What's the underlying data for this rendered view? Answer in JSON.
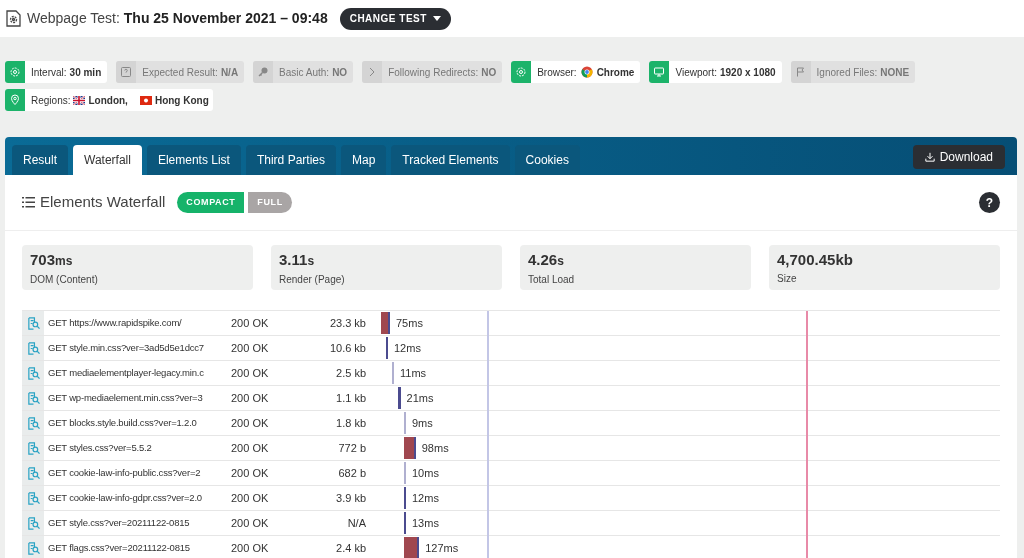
{
  "header": {
    "label": "Webpage Test:",
    "title": "Thu 25 November 2021 – 09:48",
    "button": "CHANGE TEST"
  },
  "filters": [
    {
      "kind": "gear",
      "active": true,
      "label": "Interval:",
      "value": "30 min"
    },
    {
      "kind": "question",
      "active": false,
      "label": "Expected Result:",
      "value": "N/A"
    },
    {
      "kind": "key",
      "active": false,
      "label": "Basic Auth:",
      "value": "NO"
    },
    {
      "kind": "chevron",
      "active": false,
      "label": "Following Redirects:",
      "value": "NO"
    },
    {
      "kind": "browser",
      "active": true,
      "label": "Browser:",
      "value": "Chrome"
    },
    {
      "kind": "monitor",
      "active": true,
      "label": "Viewport:",
      "value": "1920 x 1080"
    },
    {
      "kind": "flag",
      "active": false,
      "label": "Ignored Files:",
      "value": "NONE"
    }
  ],
  "regions": {
    "label": "Regions:",
    "items": [
      {
        "kind": "uk",
        "name": "London,"
      },
      {
        "kind": "hk",
        "name": "Hong Kong"
      }
    ]
  },
  "tabs": [
    {
      "label": "Result",
      "selected": false
    },
    {
      "label": "Waterfall",
      "selected": true
    },
    {
      "label": "Elements List",
      "selected": false
    },
    {
      "label": "Third Parties",
      "selected": false
    },
    {
      "label": "Map",
      "selected": false
    },
    {
      "label": "Tracked Elements",
      "selected": false
    },
    {
      "label": "Cookies",
      "selected": false
    }
  ],
  "download": "Download",
  "section": {
    "title": "Elements Waterfall",
    "modes": [
      {
        "label": "COMPACT",
        "selected": true
      },
      {
        "label": "FULL",
        "selected": false
      }
    ],
    "help": "?"
  },
  "stats": [
    {
      "value": "703",
      "unit": "ms",
      "label": "DOM (Content)"
    },
    {
      "value": "3.11",
      "unit": "s",
      "label": "Render (Page)"
    },
    {
      "value": "4.26",
      "unit": "s",
      "label": "Total Load"
    },
    {
      "value": "4,700.45kb",
      "label": "Size"
    }
  ],
  "rows": [
    {
      "request": "GET https://www.rapidspike.com/",
      "status": "200 OK",
      "size": "23.3 kb",
      "time": "75ms",
      "kind": "red"
    },
    {
      "request": "GET style.min.css?ver=3ad5d5e1dcc7",
      "status": "200 OK",
      "size": "10.6 kb",
      "time": "12ms",
      "kind": "dark"
    },
    {
      "request": "GET mediaelementplayer-legacy.min.c",
      "status": "200 OK",
      "size": "2.5 kb",
      "time": "11ms",
      "kind": "light"
    },
    {
      "request": "GET wp-mediaelement.min.css?ver=3",
      "status": "200 OK",
      "size": "1.1 kb",
      "time": "21ms",
      "kind": "dark"
    },
    {
      "request": "GET blocks.style.build.css?ver=1.2.0",
      "status": "200 OK",
      "size": "1.8 kb",
      "time": "9ms",
      "kind": "light"
    },
    {
      "request": "GET styles.css?ver=5.5.2",
      "status": "200 OK",
      "size": "772 b",
      "time": "98ms",
      "kind": "red"
    },
    {
      "request": "GET cookie-law-info-public.css?ver=2",
      "status": "200 OK",
      "size": "682 b",
      "time": "10ms",
      "kind": "light"
    },
    {
      "request": "GET cookie-law-info-gdpr.css?ver=2.0",
      "status": "200 OK",
      "size": "3.9 kb",
      "time": "12ms",
      "kind": "dark"
    },
    {
      "request": "GET style.css?ver=20211122-0815",
      "status": "200 OK",
      "size": "N/A",
      "time": "13ms",
      "kind": "dark"
    },
    {
      "request": "GET flags.css?ver=20211122-0815",
      "status": "200 OK",
      "size": "2.4 kb",
      "time": "127ms",
      "kind": "red"
    }
  ]
}
